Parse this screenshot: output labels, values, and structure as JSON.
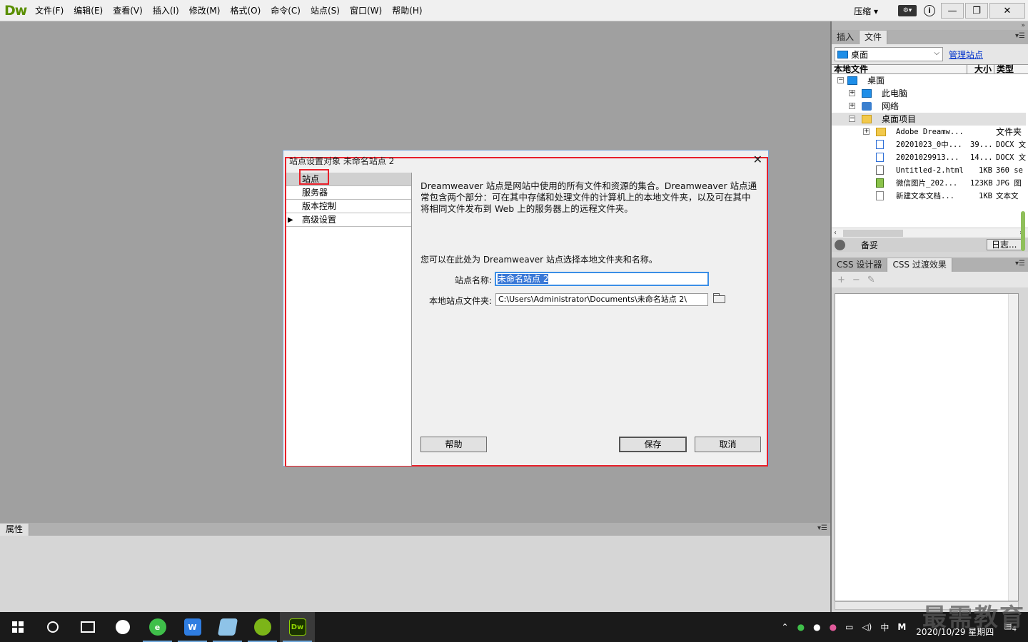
{
  "app": {
    "logo": "Dw",
    "menu": [
      "文件(F)",
      "编辑(E)",
      "查看(V)",
      "插入(I)",
      "修改(M)",
      "格式(O)",
      "命令(C)",
      "站点(S)",
      "窗口(W)",
      "帮助(H)"
    ],
    "compress_label": "压缩",
    "window_controls": {
      "minimize": "—",
      "restore": "❐",
      "close": "✕"
    }
  },
  "files_panel": {
    "tabs": [
      "插入",
      "文件"
    ],
    "active_tab": "文件",
    "site_select": "桌面",
    "manage_sites": "管理站点",
    "columns": [
      "本地文件",
      "大小",
      "类型"
    ],
    "tree": [
      {
        "label": "桌面",
        "icon": "monitor-icon",
        "expander": "⊟"
      },
      {
        "label": "此电脑",
        "icon": "computer-icon",
        "expander": "⊞"
      },
      {
        "label": "网络",
        "icon": "network-icon",
        "expander": "⊞"
      },
      {
        "label": "桌面项目",
        "icon": "folder-icon",
        "expander": "⊟"
      },
      {
        "label": "Adobe Dreamw...",
        "size": "",
        "type": "文件夹",
        "icon": "folder-icon",
        "expander": "⊞"
      },
      {
        "label": "20201023_0中...",
        "size": "39...",
        "type": "DOCX 文",
        "icon": "docx-icon"
      },
      {
        "label": "20201029913...",
        "size": "14...",
        "type": "DOCX 文",
        "icon": "docx-icon"
      },
      {
        "label": "Untitled-2.html",
        "size": "1KB",
        "type": "360 se",
        "icon": "html-icon"
      },
      {
        "label": "微信图片_202...",
        "size": "123KB",
        "type": "JPG 图",
        "icon": "image-icon"
      },
      {
        "label": "新建文本文档...",
        "size": "1KB",
        "type": "文本文",
        "icon": "text-file-icon"
      }
    ],
    "status": "备妥",
    "log_button": "日志..."
  },
  "css_panel": {
    "tabs": [
      "CSS 设计器",
      "CSS 过渡效果"
    ],
    "active_tab": "CSS 过渡效果",
    "tools": [
      "+",
      "−",
      "✎"
    ]
  },
  "properties_panel": {
    "tab": "属性"
  },
  "dialog": {
    "title": "站点设置对象 未命名站点 2",
    "categories": [
      "站点",
      "服务器",
      "版本控制",
      "高级设置"
    ],
    "active_category": "站点",
    "description": "Dreamweaver 站点是网站中使用的所有文件和资源的集合。Dreamweaver 站点通常包含两个部分：可在其中存储和处理文件的计算机上的本地文件夹，以及可在其中将相同文件发布到 Web 上的服务器上的远程文件夹。",
    "hint": "您可以在此处为 Dreamweaver 站点选择本地文件夹和名称。",
    "site_name_label": "站点名称:",
    "site_name_value": "未命名站点 2",
    "local_folder_label": "本地站点文件夹:",
    "local_folder_value": "C:\\Users\\Administrator\\Documents\\未命名站点 2\\",
    "buttons": {
      "help": "帮助",
      "save": "保存",
      "cancel": "取消"
    }
  },
  "taskbar": {
    "tray_ime": "中",
    "tray_m": "M",
    "date": "2020/10/29 星期四",
    "notifications": "4"
  },
  "watermark": "最需教育",
  "colors": {
    "highlight_red": "#e8202a",
    "dw_green": "#5a8f00",
    "selection_blue": "#3a78d6"
  }
}
